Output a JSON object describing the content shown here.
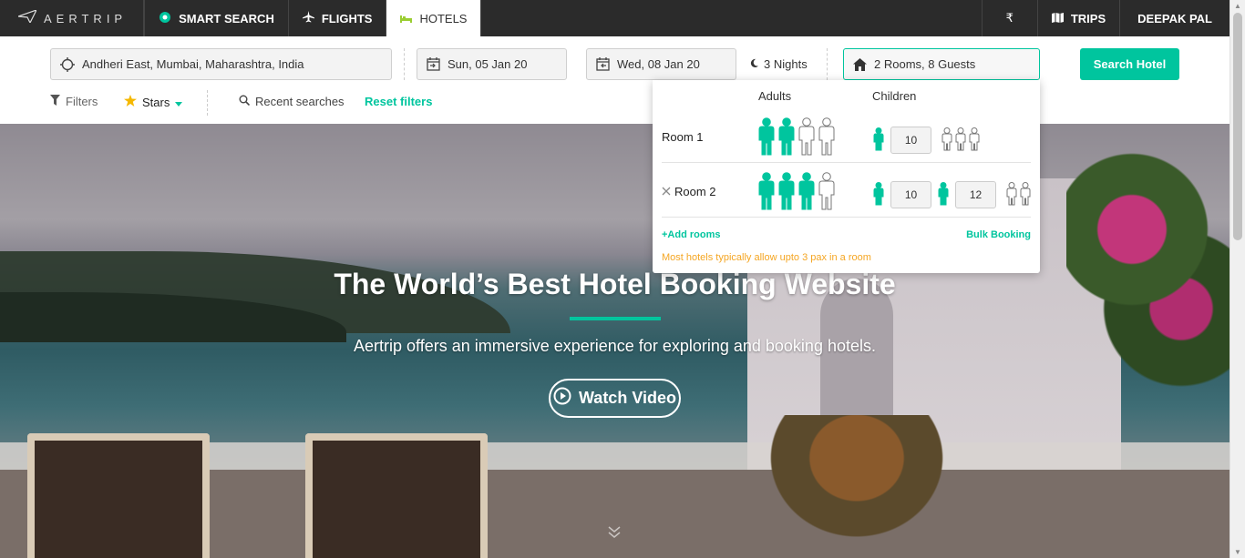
{
  "nav": {
    "logo_text": "AERTRIP",
    "items": [
      {
        "label": "SMART SEARCH",
        "icon": "chat-icon"
      },
      {
        "label": "FLIGHTS",
        "icon": "plane-icon"
      },
      {
        "label": "HOTELS",
        "icon": "bed-icon",
        "active": true
      }
    ],
    "currency": "₹",
    "trips_label": "TRIPS",
    "user_name": "DEEPAK PAL"
  },
  "search": {
    "location": "Andheri East, Mumbai, Maharashtra, India",
    "checkin": "Sun, 05 Jan 20",
    "checkout": "Wed, 08 Jan 20",
    "nights": "3 Nights",
    "guests": "2 Rooms, 8 Guests",
    "button_label": "Search Hotel"
  },
  "filters": {
    "filters_label": "Filters",
    "stars_label": "Stars",
    "recent_label": "Recent searches",
    "reset_label": "Reset filters"
  },
  "hero": {
    "title": "The World’s Best Hotel Booking Website",
    "subtitle": "Aertrip offers an immersive experience for exploring and booking hotels.",
    "watch_label": "Watch Video"
  },
  "guest_picker": {
    "adults_header": "Adults",
    "children_header": "Children",
    "rooms": [
      {
        "label": "Room 1",
        "adults_selected": 2,
        "adults_total": 4,
        "children_ages": [
          "10"
        ],
        "children_total": 4,
        "removable": false
      },
      {
        "label": "Room 2",
        "adults_selected": 3,
        "adults_total": 4,
        "children_ages": [
          "10",
          "12"
        ],
        "children_total": 4,
        "removable": true
      }
    ],
    "add_rooms_label": "+Add rooms",
    "bulk_label": "Bulk Booking",
    "note": "Most hotels typically allow upto 3 pax in a room"
  },
  "colors": {
    "accent": "#00c59e",
    "nav_bg": "#2b2b2b",
    "note": "#f5a623"
  }
}
